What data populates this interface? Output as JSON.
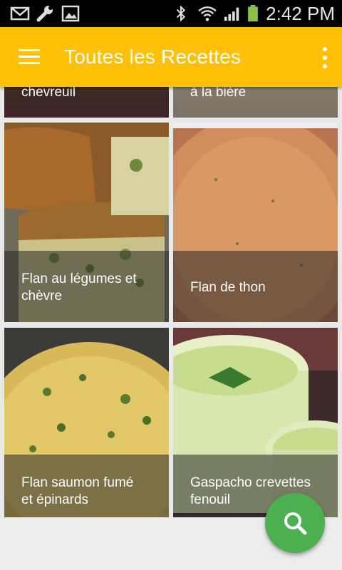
{
  "status_bar": {
    "time": "2:42 PM",
    "icons": [
      "mail-icon",
      "wrench-icon",
      "image-icon",
      "bluetooth-icon",
      "wifi-icon",
      "signal-icon",
      "battery-icon"
    ]
  },
  "app_bar": {
    "title": "Toutes les Recettes",
    "menu_icon": "hamburger-menu-icon",
    "overflow_icon": "more-vertical-icon",
    "color": "#ffc107"
  },
  "recipes": [
    {
      "name": "chevreuil"
    },
    {
      "name": "à la bière"
    },
    {
      "name": "Flan au légumes et\nchèvre"
    },
    {
      "name": "Flan de thon"
    },
    {
      "name": "Flan saumon fumé\net épinards"
    },
    {
      "name": "Gaspacho crevettes\nfenouil"
    }
  ],
  "fab": {
    "icon": "search-icon",
    "color": "#4caf50"
  }
}
